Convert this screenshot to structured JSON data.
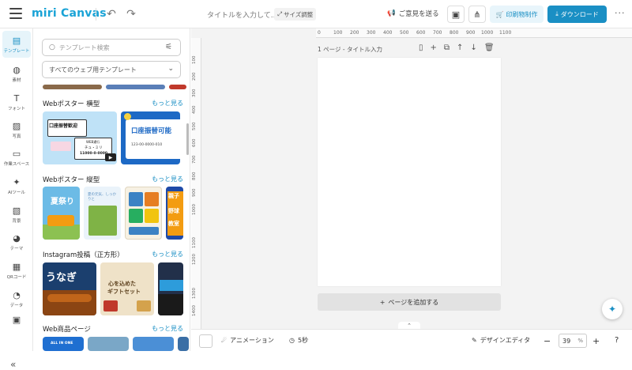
{
  "app": {
    "logo": "miri Canvas",
    "title_placeholder": "タイトルを入力して...",
    "size_label": "サイズ調整"
  },
  "header": {
    "feedback": "ご意見を送る",
    "print": "印刷物制作",
    "download": "ダウンロード",
    "more": "···"
  },
  "rail": [
    {
      "label": "テンプレート",
      "icon": "template-icon",
      "glyph": "▤",
      "active": true
    },
    {
      "label": "素材",
      "icon": "elements-icon",
      "glyph": "◍"
    },
    {
      "label": "フォント",
      "icon": "text-icon",
      "glyph": "T"
    },
    {
      "label": "写真",
      "icon": "photo-icon",
      "glyph": "▨"
    },
    {
      "label": "作業スペース",
      "icon": "workspace-icon",
      "glyph": "▭"
    },
    {
      "label": "AIツール",
      "icon": "ai-sparkle-icon",
      "glyph": "✦"
    },
    {
      "label": "背景",
      "icon": "background-icon",
      "glyph": "▧"
    },
    {
      "label": "テーマ",
      "icon": "palette-icon",
      "glyph": "◕"
    },
    {
      "label": "QRコード",
      "icon": "qr-icon",
      "glyph": "▦"
    },
    {
      "label": "データ",
      "icon": "data-chart-icon",
      "glyph": "◔"
    },
    {
      "label": "",
      "icon": "more-tools-icon",
      "glyph": "▣"
    }
  ],
  "panel": {
    "search_placeholder": "テンプレート検索",
    "select": "すべてのウェブ用テンプレート",
    "more": "もっと見る",
    "sections": [
      {
        "title": "Webポスター 横型"
      },
      {
        "title": "Webポスター 縦型"
      },
      {
        "title": "Instagram投稿（正方形）"
      },
      {
        "title": "Web商品ページ"
      }
    ],
    "thumb_texts": {
      "t1a": "口座振替歓迎",
      "t1b": "WEB通行",
      "t1c": "チュ・ミリ",
      "t1d": "11000-0-0000",
      "t2a": "口座振替可能",
      "t2b": "123-00-0000-010",
      "t3a": "夏祭り",
      "t4a": "夏の元気、しっかりと",
      "t6a": "親子",
      "t6b": "野球",
      "t6c": "教室",
      "t7a": "うなぎ",
      "t8a": "心を込めた",
      "t8b": "ギフトセット",
      "t10a": "ALL IN ONE"
    }
  },
  "canvas": {
    "page_label": "1 ページ - タイトル入力",
    "add_page": "ページを追加する",
    "ruler_top": [
      "0",
      "100",
      "200",
      "300",
      "400",
      "500",
      "600",
      "700",
      "800",
      "900",
      "1000",
      "1100"
    ],
    "ruler_left": [
      "100",
      "200",
      "300",
      "400",
      "500",
      "600",
      "700",
      "800",
      "900",
      "1000",
      "1100",
      "1200",
      "1300",
      "1400"
    ]
  },
  "bottom": {
    "animation": "アニメーション",
    "duration": "5秒",
    "design_editor": "デザインエディタ",
    "zoom": "39",
    "zoom_unit": "%"
  }
}
